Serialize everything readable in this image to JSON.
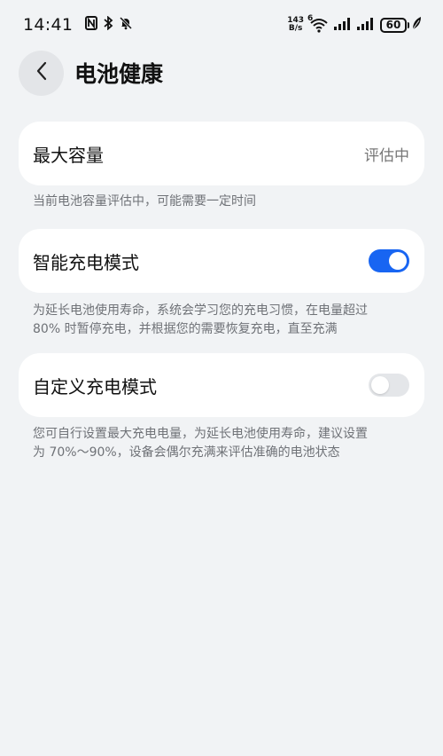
{
  "status_bar": {
    "time": "14:41",
    "net_speed_value": "143",
    "net_speed_unit": "B/s",
    "wifi_label": "6",
    "battery_level": "60"
  },
  "header": {
    "title": "电池健康"
  },
  "max_capacity": {
    "label": "最大容量",
    "value": "评估中",
    "description": "当前电池容量评估中，可能需要一定时间"
  },
  "smart_charging": {
    "label": "智能充电模式",
    "enabled": true,
    "description_line1": "为延长电池使用寿命，系统会学习您的充电习惯，在电量超过",
    "description_line2": "80% 时暂停充电，并根据您的需要恢复充电，直至充满"
  },
  "custom_charging": {
    "label": "自定义充电模式",
    "enabled": false,
    "description_line1": "您可自行设置最大充电电量，为延长电池使用寿命，建议设置",
    "description_line2": "为 70%～90%，设备会偶尔充满来评估准确的电池状态"
  },
  "colors": {
    "background": "#f1f3f5",
    "card": "#ffffff",
    "accent": "#1865f2",
    "secondary_text": "#6f7277"
  }
}
